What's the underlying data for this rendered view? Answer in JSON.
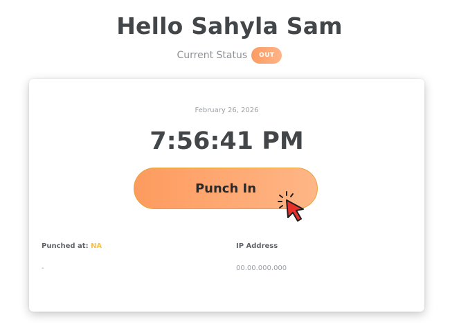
{
  "greeting": "Hello Sahyla Sam",
  "status": {
    "label": "Current Status",
    "badge": "OUT",
    "badge_color": "#fba26e"
  },
  "clock": {
    "date": "February 26, 2026",
    "time": "7:56:41 PM"
  },
  "punch_button": {
    "label": "Punch In",
    "gradient_start": "#fd9b5f",
    "gradient_end": "#ffb686",
    "border_color": "#e7a33a"
  },
  "punched_at": {
    "label": "Punched at:",
    "value_inline": "NA",
    "value": "-"
  },
  "ip_address": {
    "label": "IP Address",
    "value": "00.00.000.000"
  },
  "cursor": {
    "icon": "pointer-cursor-icon",
    "color": "#e8302a"
  }
}
